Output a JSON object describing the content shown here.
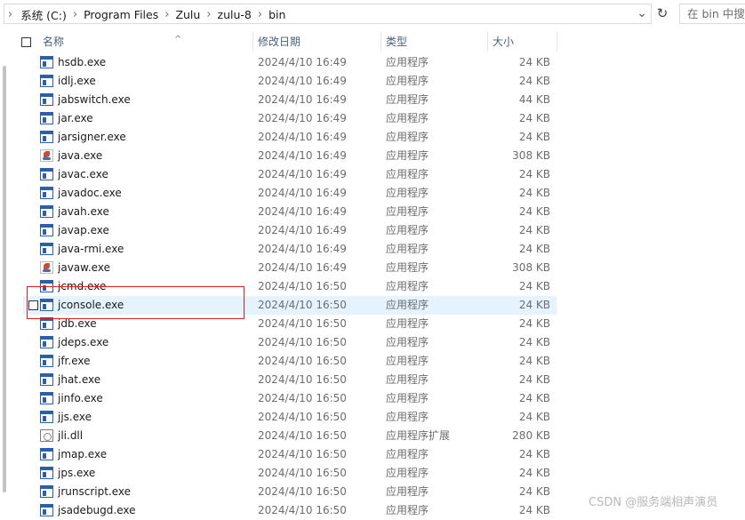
{
  "address": {
    "breadcrumbs": [
      "系统 (C:)",
      "Program Files",
      "Zulu",
      "zulu-8",
      "bin"
    ],
    "lead_chevron": "›",
    "separator": "›",
    "dropdown_glyph": "⌄",
    "refresh_glyph": "↻",
    "search_placeholder": "在 bin 中搜索"
  },
  "columns": {
    "name": "名称",
    "modified": "修改日期",
    "type": "类型",
    "size": "大小",
    "sort_glyph": "^"
  },
  "files": [
    {
      "name": "hsdb.exe",
      "date": "2024/4/10 16:49",
      "type": "应用程序",
      "size": "24 KB",
      "icon": "exe-icon"
    },
    {
      "name": "idlj.exe",
      "date": "2024/4/10 16:49",
      "type": "应用程序",
      "size": "24 KB",
      "icon": "exe-icon"
    },
    {
      "name": "jabswitch.exe",
      "date": "2024/4/10 16:49",
      "type": "应用程序",
      "size": "44 KB",
      "icon": "exe-icon"
    },
    {
      "name": "jar.exe",
      "date": "2024/4/10 16:49",
      "type": "应用程序",
      "size": "24 KB",
      "icon": "exe-icon"
    },
    {
      "name": "jarsigner.exe",
      "date": "2024/4/10 16:49",
      "type": "应用程序",
      "size": "24 KB",
      "icon": "exe-icon"
    },
    {
      "name": "java.exe",
      "date": "2024/4/10 16:49",
      "type": "应用程序",
      "size": "308 KB",
      "icon": "java-icon"
    },
    {
      "name": "javac.exe",
      "date": "2024/4/10 16:49",
      "type": "应用程序",
      "size": "24 KB",
      "icon": "exe-icon"
    },
    {
      "name": "javadoc.exe",
      "date": "2024/4/10 16:49",
      "type": "应用程序",
      "size": "24 KB",
      "icon": "exe-icon"
    },
    {
      "name": "javah.exe",
      "date": "2024/4/10 16:49",
      "type": "应用程序",
      "size": "24 KB",
      "icon": "exe-icon"
    },
    {
      "name": "javap.exe",
      "date": "2024/4/10 16:49",
      "type": "应用程序",
      "size": "24 KB",
      "icon": "exe-icon"
    },
    {
      "name": "java-rmi.exe",
      "date": "2024/4/10 16:49",
      "type": "应用程序",
      "size": "24 KB",
      "icon": "exe-icon"
    },
    {
      "name": "javaw.exe",
      "date": "2024/4/10 16:49",
      "type": "应用程序",
      "size": "308 KB",
      "icon": "java-icon"
    },
    {
      "name": "jcmd.exe",
      "date": "2024/4/10 16:50",
      "type": "应用程序",
      "size": "24 KB",
      "icon": "exe-icon"
    },
    {
      "name": "jconsole.exe",
      "date": "2024/4/10 16:50",
      "type": "应用程序",
      "size": "24 KB",
      "icon": "exe-icon",
      "selected": true
    },
    {
      "name": "jdb.exe",
      "date": "2024/4/10 16:50",
      "type": "应用程序",
      "size": "24 KB",
      "icon": "exe-icon"
    },
    {
      "name": "jdeps.exe",
      "date": "2024/4/10 16:50",
      "type": "应用程序",
      "size": "24 KB",
      "icon": "exe-icon"
    },
    {
      "name": "jfr.exe",
      "date": "2024/4/10 16:50",
      "type": "应用程序",
      "size": "24 KB",
      "icon": "exe-icon"
    },
    {
      "name": "jhat.exe",
      "date": "2024/4/10 16:50",
      "type": "应用程序",
      "size": "24 KB",
      "icon": "exe-icon"
    },
    {
      "name": "jinfo.exe",
      "date": "2024/4/10 16:50",
      "type": "应用程序",
      "size": "24 KB",
      "icon": "exe-icon"
    },
    {
      "name": "jjs.exe",
      "date": "2024/4/10 16:50",
      "type": "应用程序",
      "size": "24 KB",
      "icon": "exe-icon"
    },
    {
      "name": "jli.dll",
      "date": "2024/4/10 16:50",
      "type": "应用程序扩展",
      "size": "280 KB",
      "icon": "dll-icon"
    },
    {
      "name": "jmap.exe",
      "date": "2024/4/10 16:50",
      "type": "应用程序",
      "size": "24 KB",
      "icon": "exe-icon"
    },
    {
      "name": "jps.exe",
      "date": "2024/4/10 16:50",
      "type": "应用程序",
      "size": "24 KB",
      "icon": "exe-icon"
    },
    {
      "name": "jrunscript.exe",
      "date": "2024/4/10 16:50",
      "type": "应用程序",
      "size": "24 KB",
      "icon": "exe-icon"
    },
    {
      "name": "jsadebugd.exe",
      "date": "2024/4/10 16:50",
      "type": "应用程序",
      "size": "24 KB",
      "icon": "exe-icon"
    }
  ],
  "watermark": "CSDN @服务端相声演员",
  "colors": {
    "selection": "#e5f3ff",
    "highlight_box": "#e02020",
    "header_text": "#4c607a"
  }
}
